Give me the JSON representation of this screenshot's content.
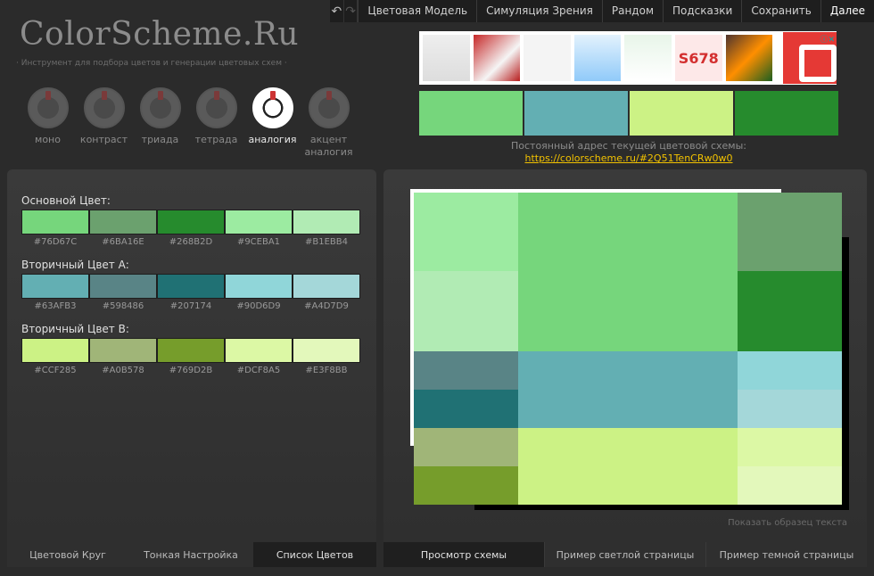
{
  "menu": {
    "undo_icon": "undo-icon",
    "redo_icon": "redo-icon",
    "items": [
      "Цветовая Модель",
      "Симуляция Зрения",
      "Рандом",
      "Подсказки",
      "Сохранить",
      "Далее"
    ]
  },
  "header": {
    "logo": "ColorScheme.Ru",
    "tagline": "· Инструмент для подбора цветов и генерации цветовых схем ·"
  },
  "schemes": [
    "моно",
    "контраст",
    "триада",
    "тетрада",
    "аналогия",
    "акцент аналогия"
  ],
  "active_scheme": "аналогия",
  "ad_text": "S678",
  "main_colors": [
    "#76D67C",
    "#63AFB3",
    "#CCF285",
    "#268B2D"
  ],
  "permalink": {
    "label": "Постоянный адрес текущей цветовой схемы:",
    "url": "https://colorscheme.ru/#2Q51TenCRw0w0"
  },
  "palette": {
    "primary": {
      "title": "Основной Цвет:",
      "colors": [
        "#76D67C",
        "#6BA16E",
        "#268B2D",
        "#9CEBA1",
        "#B1EBB4"
      ]
    },
    "secondary_a": {
      "title": "Вторичный Цвет А:",
      "colors": [
        "#63AFB3",
        "#598486",
        "#207174",
        "#90D6D9",
        "#A4D7D9"
      ]
    },
    "secondary_b": {
      "title": "Вторичный Цвет В:",
      "colors": [
        "#CCF285",
        "#A0B578",
        "#769D2B",
        "#DCF8A5",
        "#E3F8BB"
      ]
    }
  },
  "left_tabs": [
    "Цветовой Круг",
    "Тонкая Настройка",
    "Список Цветов"
  ],
  "right_tabs": [
    "Просмотр схемы",
    "Пример светлой страницы",
    "Пример темной страницы"
  ],
  "show_sample_text": "Показать образец текста"
}
